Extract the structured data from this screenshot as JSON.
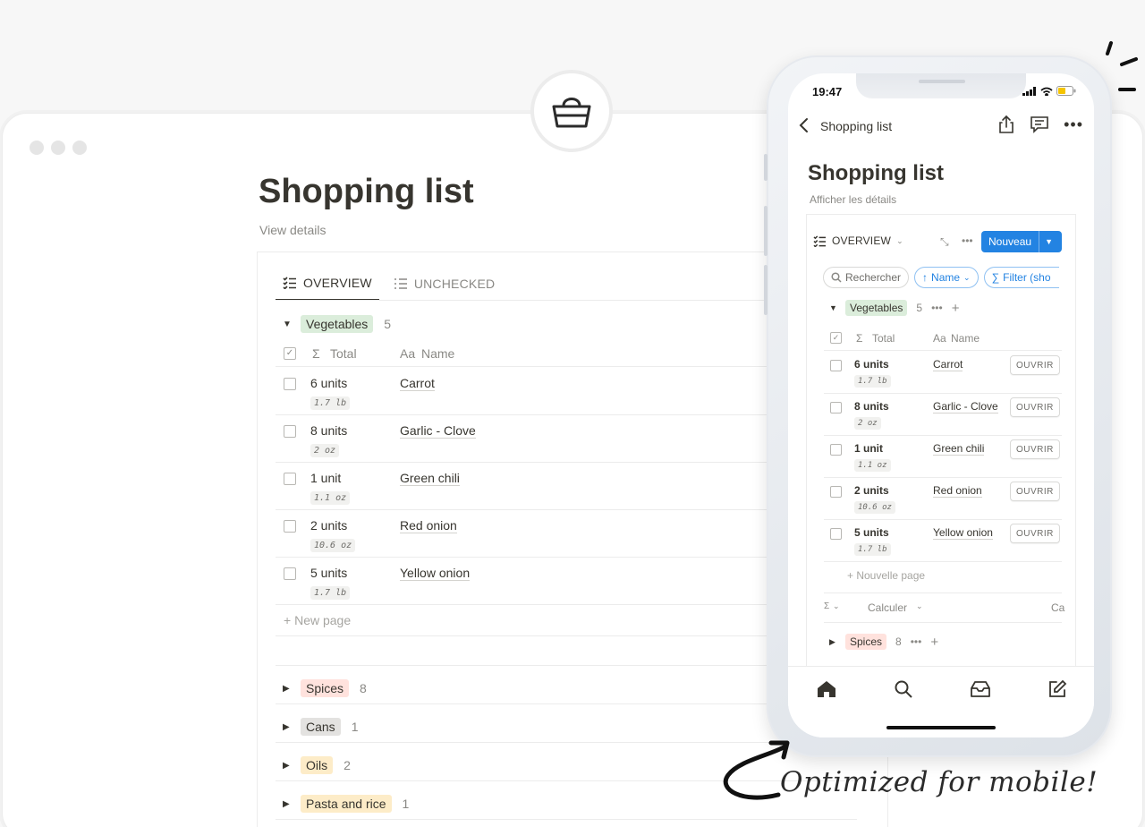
{
  "desktop": {
    "title": "Shopping list",
    "view_details": "View details",
    "tabs": [
      {
        "label": "OVERVIEW",
        "active": true
      },
      {
        "label": "UNCHECKED",
        "active": false
      }
    ],
    "columns": {
      "total": "Total",
      "total_icon": "Σ",
      "name": "Name",
      "name_icon": "Aa"
    },
    "groups": [
      {
        "label": "Vegetables",
        "count": "5",
        "color": "#dbeddb",
        "expanded": true
      },
      {
        "label": "Spices",
        "count": "8",
        "color": "#ffe2dd",
        "expanded": false
      },
      {
        "label": "Cans",
        "count": "1",
        "color": "#e3e2e0",
        "expanded": false
      },
      {
        "label": "Oils",
        "count": "2",
        "color": "#fdecc8",
        "expanded": false
      },
      {
        "label": "Pasta and rice",
        "count": "1",
        "color": "#fdecc8",
        "expanded": false
      }
    ],
    "rows": [
      {
        "units": "6 units",
        "weight": "1.7 lb",
        "name": "Carrot"
      },
      {
        "units": "8 units",
        "weight": "2 oz",
        "name": "Garlic - Clove"
      },
      {
        "units": "1 unit",
        "weight": "1.1 oz",
        "name": "Green chili"
      },
      {
        "units": "2 units",
        "weight": "10.6 oz",
        "name": "Red onion"
      },
      {
        "units": "5 units",
        "weight": "1.7 lb",
        "name": "Yellow onion"
      }
    ],
    "new_page": "New page"
  },
  "mobile": {
    "time": "19:47",
    "breadcrumb": "Shopping list",
    "title": "Shopping list",
    "details": "Afficher les détails",
    "view_label": "OVERVIEW",
    "new_button": "Nouveau",
    "search_pill": "Rechercher",
    "sort_pill": "Name",
    "filter_pill": "Filter (sho",
    "columns": {
      "total": "Total",
      "total_icon": "Σ",
      "name": "Name",
      "name_icon": "Aa"
    },
    "groups": [
      {
        "label": "Vegetables",
        "count": "5",
        "color": "#dbeddb"
      },
      {
        "label": "Spices",
        "count": "8",
        "color": "#ffe2dd"
      }
    ],
    "rows": [
      {
        "units": "6 units",
        "weight": "1.7 lb",
        "name": "Carrot",
        "open": "OUVRIR"
      },
      {
        "units": "8 units",
        "weight": "2 oz",
        "name": "Garlic - Clove",
        "open": "OUVRIR"
      },
      {
        "units": "1 unit",
        "weight": "1.1 oz",
        "name": "Green chili",
        "open": "OUVRIR"
      },
      {
        "units": "2 units",
        "weight": "10.6 oz",
        "name": "Red onion",
        "open": "OUVRIR"
      },
      {
        "units": "5 units",
        "weight": "1.7 lb",
        "name": "Yellow onion",
        "open": "OUVRIR"
      }
    ],
    "new_page": "Nouvelle page",
    "calc_label": "Calculer",
    "calc_sigma": "Σ",
    "calc_trunc": "Ca",
    "accent": "#2383e2"
  },
  "tagline": "Optimized for mobile!"
}
